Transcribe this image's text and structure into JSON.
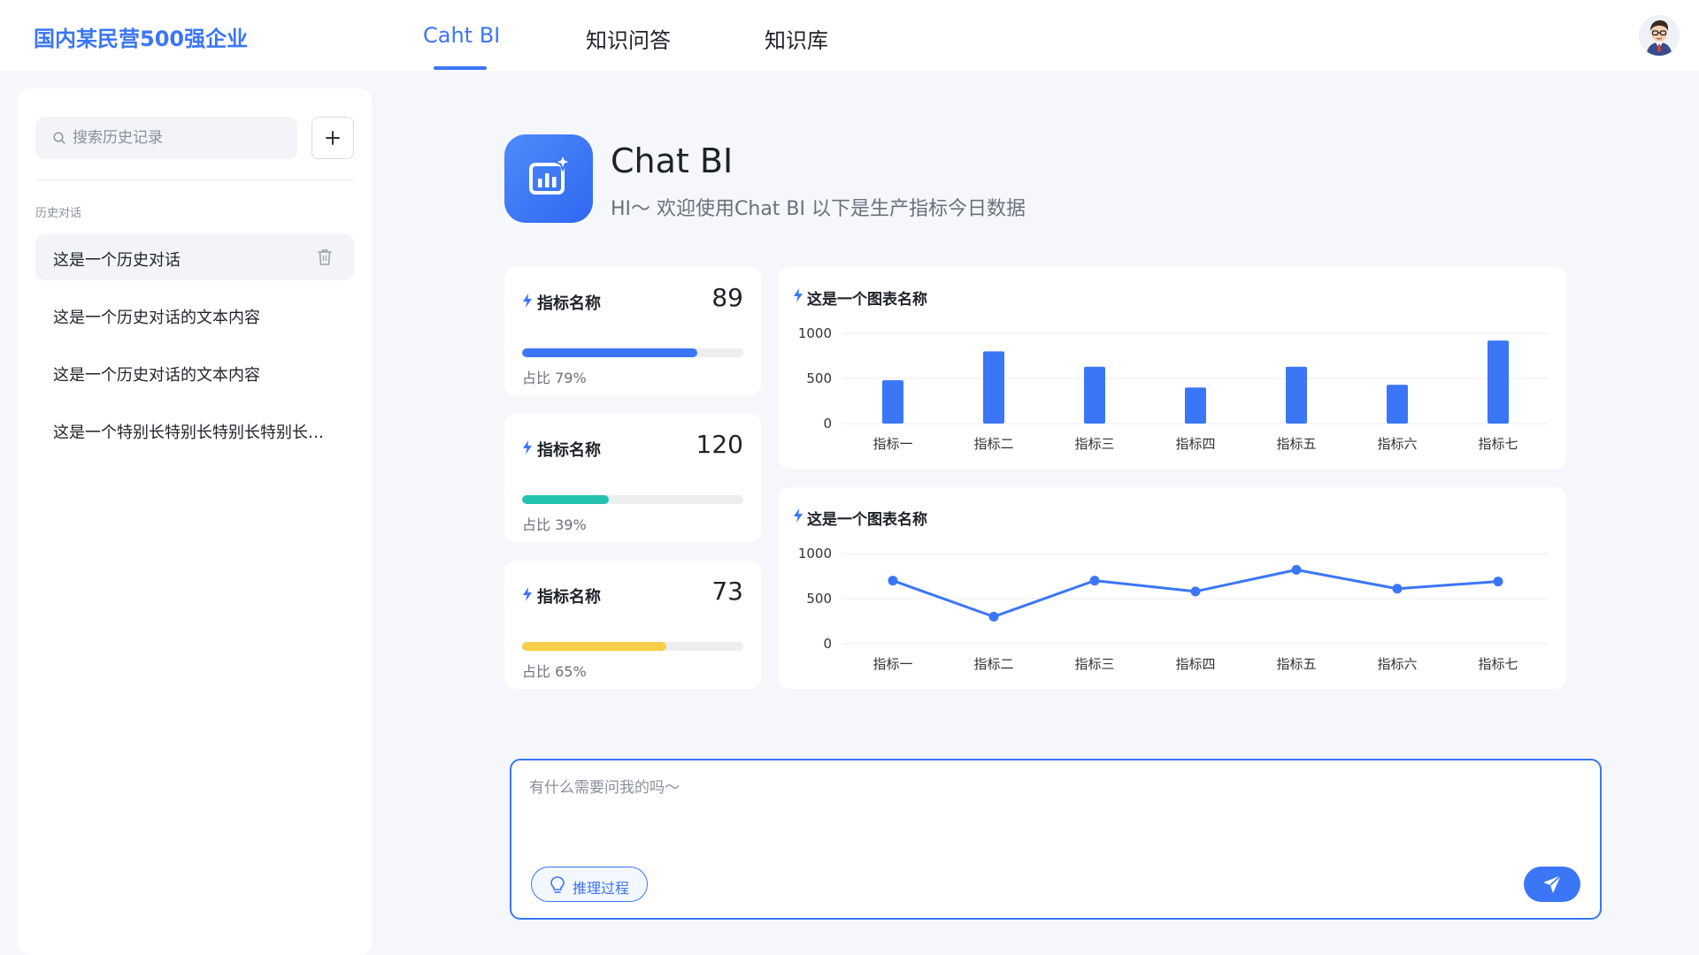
{
  "header": {
    "brand": "国内某民营500强企业",
    "tabs": [
      {
        "label": "Caht BI",
        "active": true
      },
      {
        "label": "知识问答",
        "active": false
      },
      {
        "label": "知识库",
        "active": false
      }
    ]
  },
  "sidebar": {
    "search_placeholder": "搜索历史记录",
    "section_label": "历史对话",
    "items": [
      {
        "label": "这是一个历史对话",
        "active": true
      },
      {
        "label": "这是一个历史对话的文本内容",
        "active": false
      },
      {
        "label": "这是一个历史对话的文本内容",
        "active": false
      },
      {
        "label": "这是一个特别长特别长特别长特别长特别长特别长",
        "active": false
      }
    ]
  },
  "hero": {
    "title": "Chat BI",
    "subtitle": "HI～ 欢迎使用Chat BI 以下是生产指标今日数据"
  },
  "metrics": [
    {
      "name": "指标名称",
      "value": "89",
      "ratio_label": "占比 79%",
      "ratio": 0.79,
      "color": "#3b76f6"
    },
    {
      "name": "指标名称",
      "value": "120",
      "ratio_label": "占比 39%",
      "ratio": 0.39,
      "color": "#22c1b0"
    },
    {
      "name": "指标名称",
      "value": "73",
      "ratio_label": "占比 65%",
      "ratio": 0.65,
      "color": "#f7cf48"
    }
  ],
  "chart_data": [
    {
      "type": "bar",
      "title": "这是一个图表名称",
      "categories": [
        "指标一",
        "指标二",
        "指标三",
        "指标四",
        "指标五",
        "指标六",
        "指标七"
      ],
      "values": [
        480,
        800,
        630,
        400,
        630,
        430,
        920
      ],
      "ylim": [
        0,
        1000
      ],
      "yticks": [
        0,
        500,
        1000
      ],
      "color": "#3b76f6",
      "grid": true
    },
    {
      "type": "line",
      "title": "这是一个图表名称",
      "categories": [
        "指标一",
        "指标二",
        "指标三",
        "指标四",
        "指标五",
        "指标六",
        "指标七"
      ],
      "values": [
        700,
        300,
        700,
        580,
        820,
        610,
        690
      ],
      "ylim": [
        0,
        1000
      ],
      "yticks": [
        0,
        500,
        1000
      ],
      "color": "#3b76f6",
      "grid": true
    }
  ],
  "composer": {
    "placeholder": "有什么需要问我的吗～",
    "reason_label": "推理过程"
  },
  "icons": {
    "search": "search-icon",
    "add": "plus-icon",
    "trash": "trash-icon",
    "bolt": "lightning-icon",
    "hero": "bar-chart-sparkle-icon",
    "bulb": "lightbulb-icon",
    "send": "paper-plane-icon",
    "avatar": "user-avatar"
  }
}
